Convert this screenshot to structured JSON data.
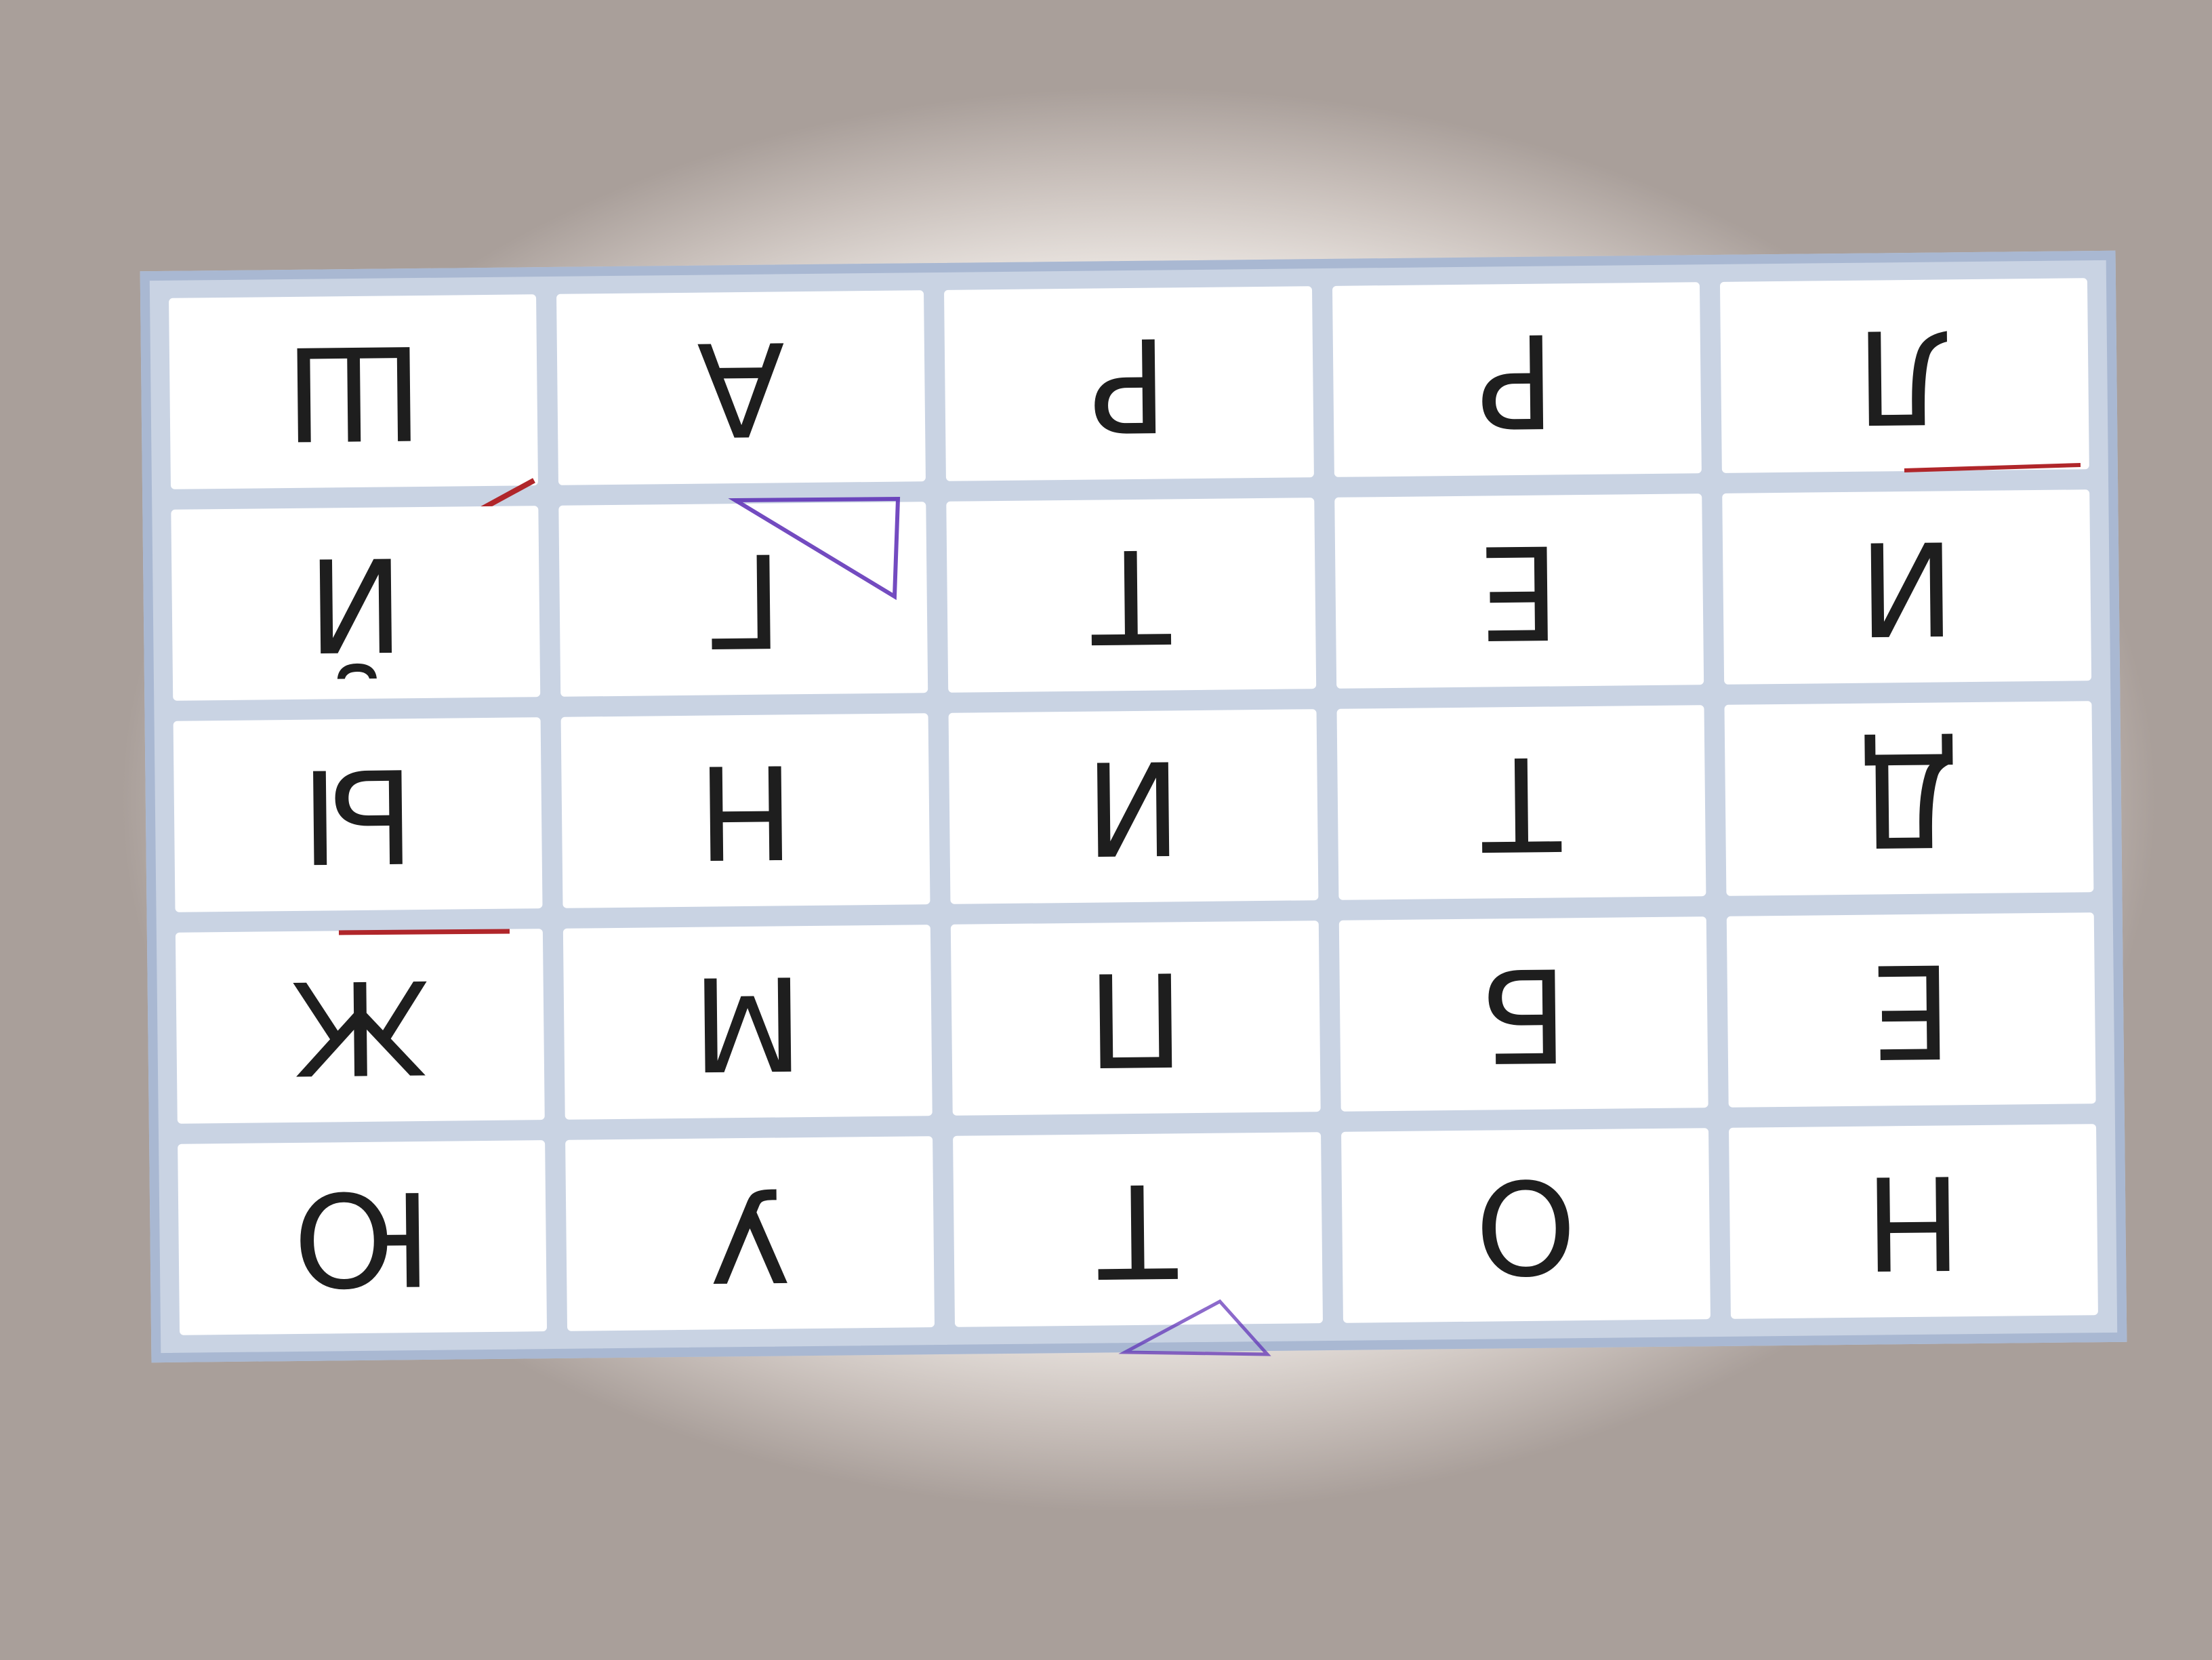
{
  "board": {
    "rows": [
      [
        "Ш",
        "А",
        "Р",
        "Р",
        "Л"
      ],
      [
        "Й",
        "Г",
        "Т",
        "Е",
        "И"
      ],
      [
        "Ы",
        "Н",
        "И",
        "Т",
        "Д"
      ],
      [
        "Ж",
        "М",
        "П",
        "Б",
        "Е"
      ],
      [
        "Ю",
        "У",
        "Т",
        "О",
        "Н"
      ]
    ],
    "orientation": "rotated-180",
    "colors": {
      "frame": "#a9b8d2",
      "cell": "#ffffff",
      "letter": "#1e1e1e",
      "red_mark": "#b0262a",
      "purple_mark": "#5b2bb5"
    }
  }
}
